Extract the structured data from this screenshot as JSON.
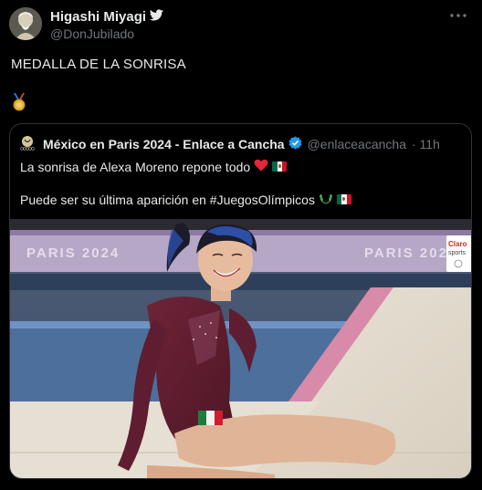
{
  "tweet": {
    "author_name": "Higashi Miyagi",
    "handle": "@DonJubilado",
    "text": "MEDALLA DE LA SONRISA",
    "emoji_icon": "medal-icon"
  },
  "quote": {
    "author_name": "México en Paris 2024 - Enlace a Cancha",
    "handle": "@enlaceacancha",
    "time": "· 11h",
    "line1": "La sonrisa de Alexa Moreno repone todo",
    "line2": "Puede ser su última aparición en #JuegosOlímpicos",
    "media": {
      "banner_left": "PARIS 2024",
      "banner_right": "PARIS 2024",
      "sponsor_top": "Claro",
      "sponsor_bottom": "sports"
    }
  },
  "colors": {
    "background": "#000000",
    "text": "#e7e9ea",
    "muted": "#71767b",
    "border": "#2f3336",
    "verified": "#1d9bf0",
    "heart": "#f91880"
  }
}
